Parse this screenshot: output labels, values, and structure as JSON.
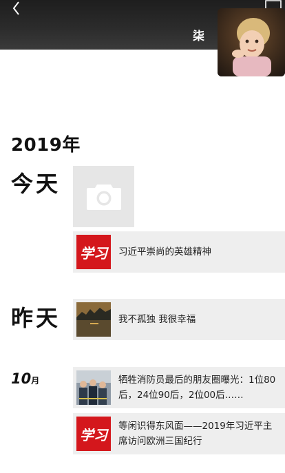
{
  "header": {
    "username": "柒",
    "back_icon": "chevron-left-icon",
    "message_icon": "message-icon"
  },
  "timeline": {
    "year": "2019年",
    "today": {
      "label": "今天",
      "camera_icon": "camera-icon"
    },
    "posts_today": [
      {
        "thumb": "xuexi-logo",
        "thumb_text": "学习",
        "text": "习近平崇尚的英雄精神"
      }
    ],
    "yesterday": {
      "label": "昨天",
      "posts": [
        {
          "thumb": "sunset-photo",
          "text": "我不孤独 我很幸福"
        }
      ]
    },
    "october": {
      "num": "10",
      "unit": "月",
      "posts": [
        {
          "thumb": "firefighters-photo",
          "text": "牺牲消防员最后的朋友圈曝光：1位80后，24位90后，2位00后……"
        },
        {
          "thumb": "xuexi-logo",
          "thumb_text": "学习",
          "text": "等闲识得东风面——2019年习近平主席访问欧洲三国纪行"
        }
      ]
    }
  },
  "colors": {
    "cover_dark": "#2b2b2b",
    "post_bg": "#eeeeee",
    "xuexi_red": "#d4171c"
  }
}
